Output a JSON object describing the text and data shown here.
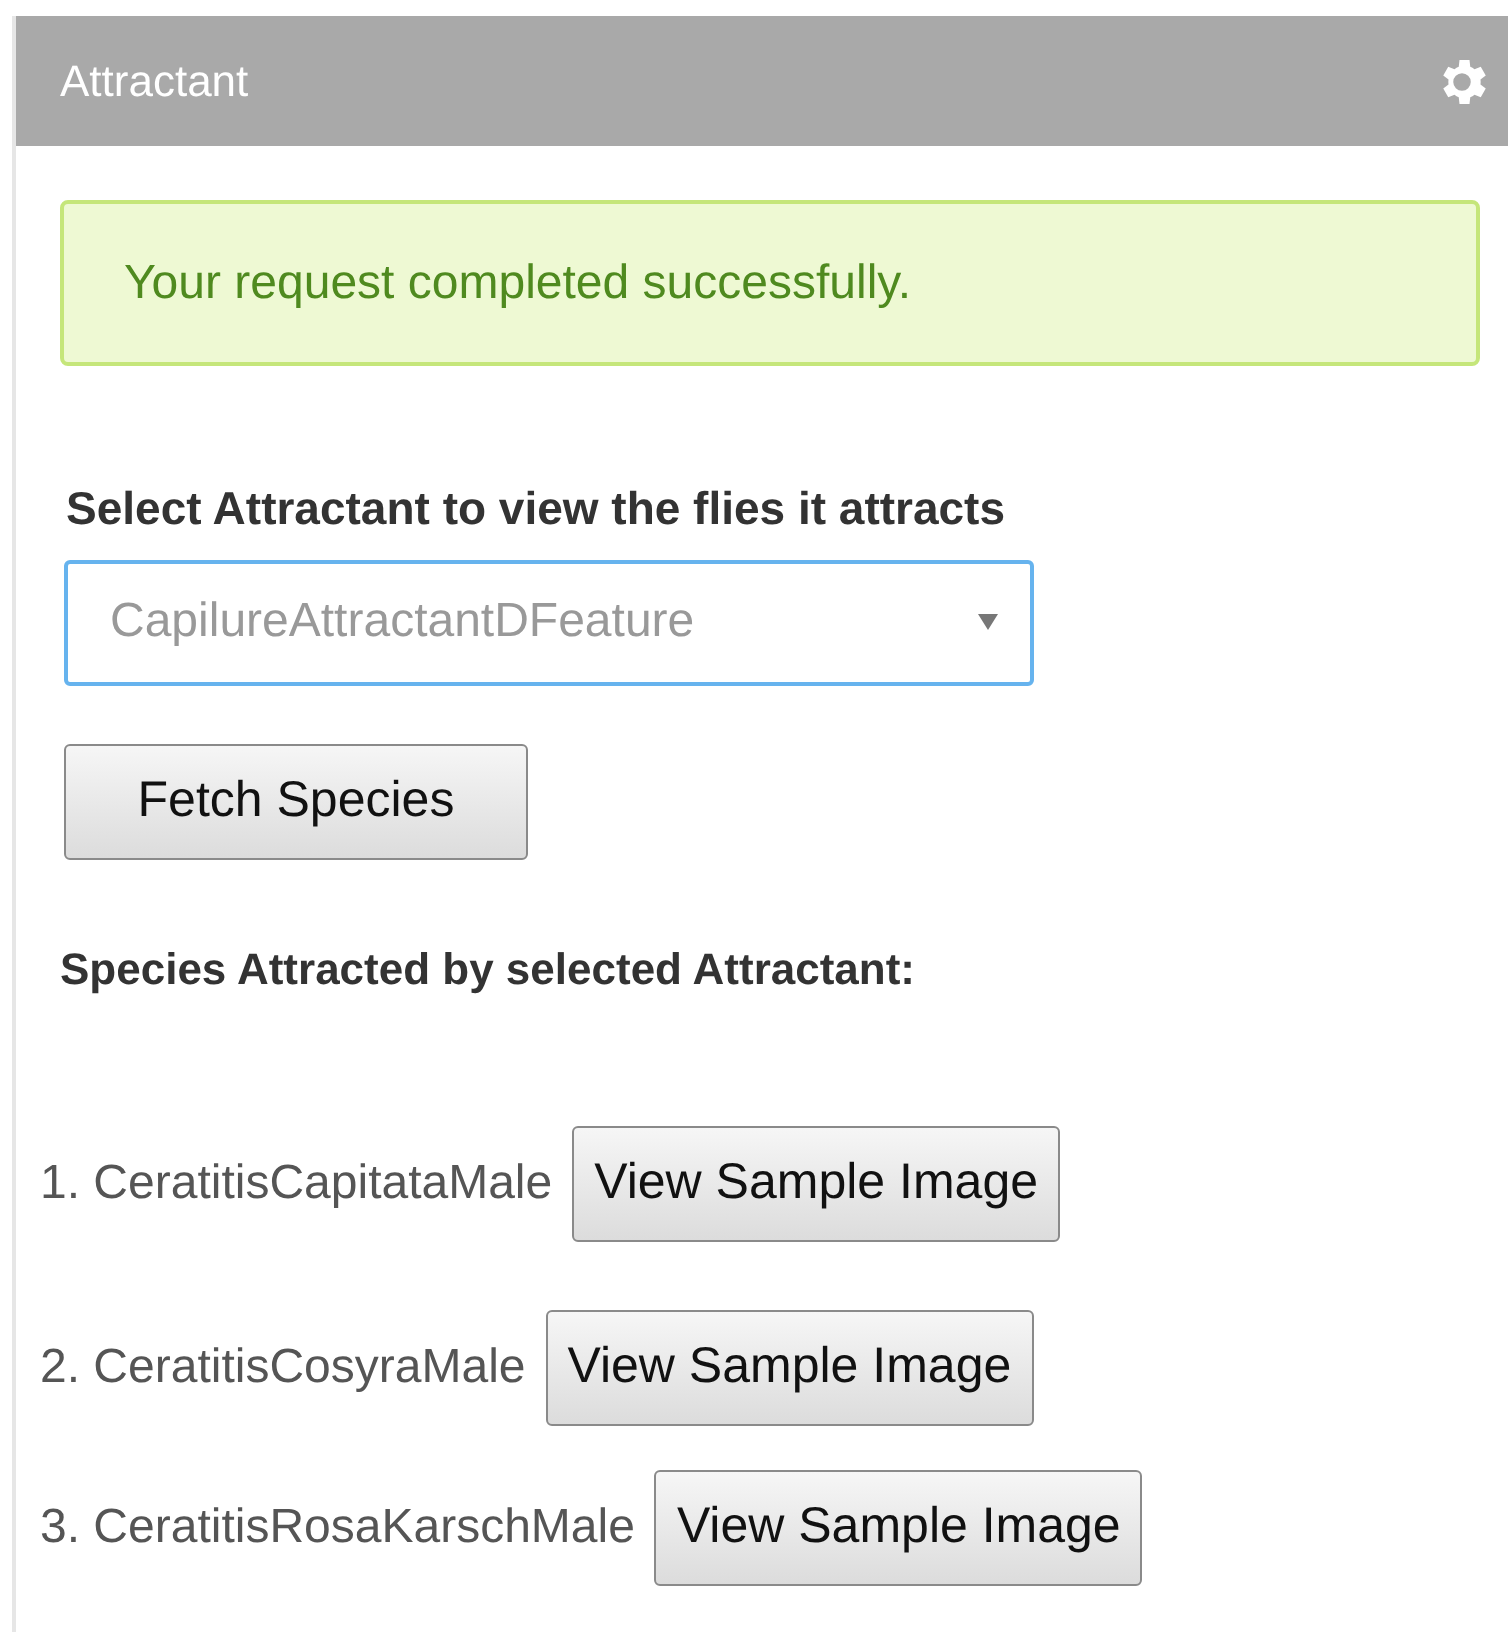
{
  "panel": {
    "title": "Attractant"
  },
  "alert": {
    "message": "Your request completed successfully."
  },
  "select_label": "Select Attractant to view the flies it attracts",
  "select": {
    "value": "CapilureAttractantDFeature"
  },
  "fetch_button": "Fetch Species",
  "species_heading": "Species Attracted by selected Attractant:",
  "species": [
    {
      "label": "1. CeratitisCapitataMale",
      "button": "View Sample Image"
    },
    {
      "label": "2. CeratitisCosyraMale",
      "button": "View Sample Image"
    },
    {
      "label": "3. CeratitisRosaKarschMale",
      "button": "View Sample Image"
    }
  ]
}
